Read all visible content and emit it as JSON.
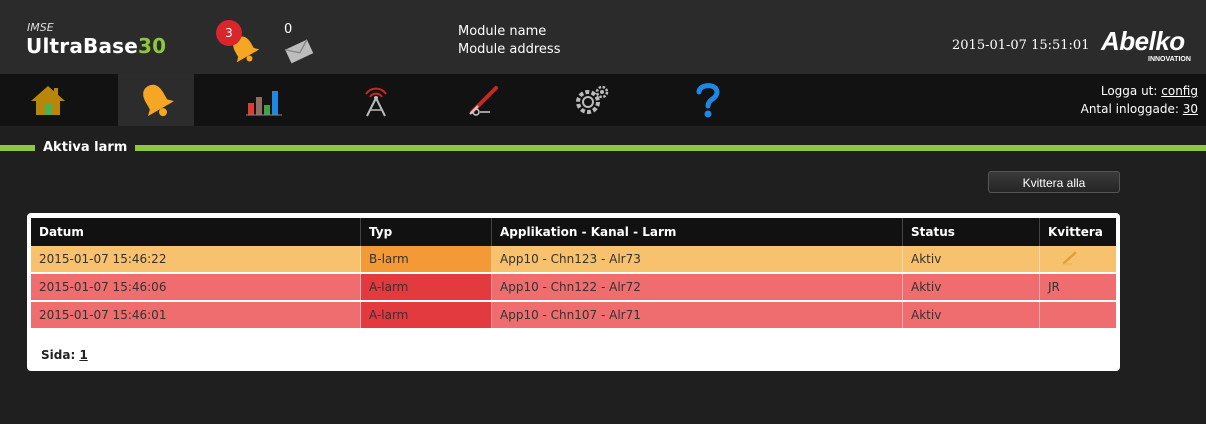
{
  "header": {
    "brand_small": "IMSE",
    "brand_main": "UltraBase",
    "brand_accent": "30",
    "alarm_count": "3",
    "message_count": "0",
    "module_name": "Module name",
    "module_address": "Module address",
    "datetime": "2015-01-07 15:51:01",
    "logo_main": "Abelko",
    "logo_sub": "INNOVATION"
  },
  "nav": {
    "items": [
      {
        "icon": "home-icon"
      },
      {
        "icon": "bell-icon"
      },
      {
        "icon": "bar-chart-icon"
      },
      {
        "icon": "antenna-icon"
      },
      {
        "icon": "tools-icon"
      },
      {
        "icon": "gears-icon"
      },
      {
        "icon": "help-icon"
      }
    ],
    "logout_label": "Logga ut:",
    "logout_user": "config",
    "logged_in_label": "Antal inloggade:",
    "logged_in_count": "30"
  },
  "section": {
    "title": "Aktiva larm",
    "ack_all_label": "Kvittera alla"
  },
  "table": {
    "columns": [
      "Datum",
      "Typ",
      "Applikation - Kanal - Larm",
      "Status",
      "Kvittera"
    ],
    "rows": [
      {
        "date": "2015-01-07 15:46:22",
        "type": "B-larm",
        "alarm": "App10 - Chn123 - Alr73",
        "status": "Aktiv",
        "ack": ""
      },
      {
        "date": "2015-01-07 15:46:06",
        "type": "A-larm",
        "alarm": "App10 - Chn122 - Alr72",
        "status": "Aktiv",
        "ack": "JR"
      },
      {
        "date": "2015-01-07 15:46:01",
        "type": "A-larm",
        "alarm": "App10 - Chn107 - Alr71",
        "status": "Aktiv",
        "ack": ""
      }
    ],
    "page_label": "Sida:",
    "page_number": "1"
  },
  "colors": {
    "accent": "#8dc63f",
    "b_alarm_row": "#f7c16e",
    "b_alarm_type": "#f39a37",
    "a_alarm_row": "#ef6c6f",
    "a_alarm_type": "#e23a3f",
    "badge": "#d9262c",
    "help": "#1e88e5"
  }
}
